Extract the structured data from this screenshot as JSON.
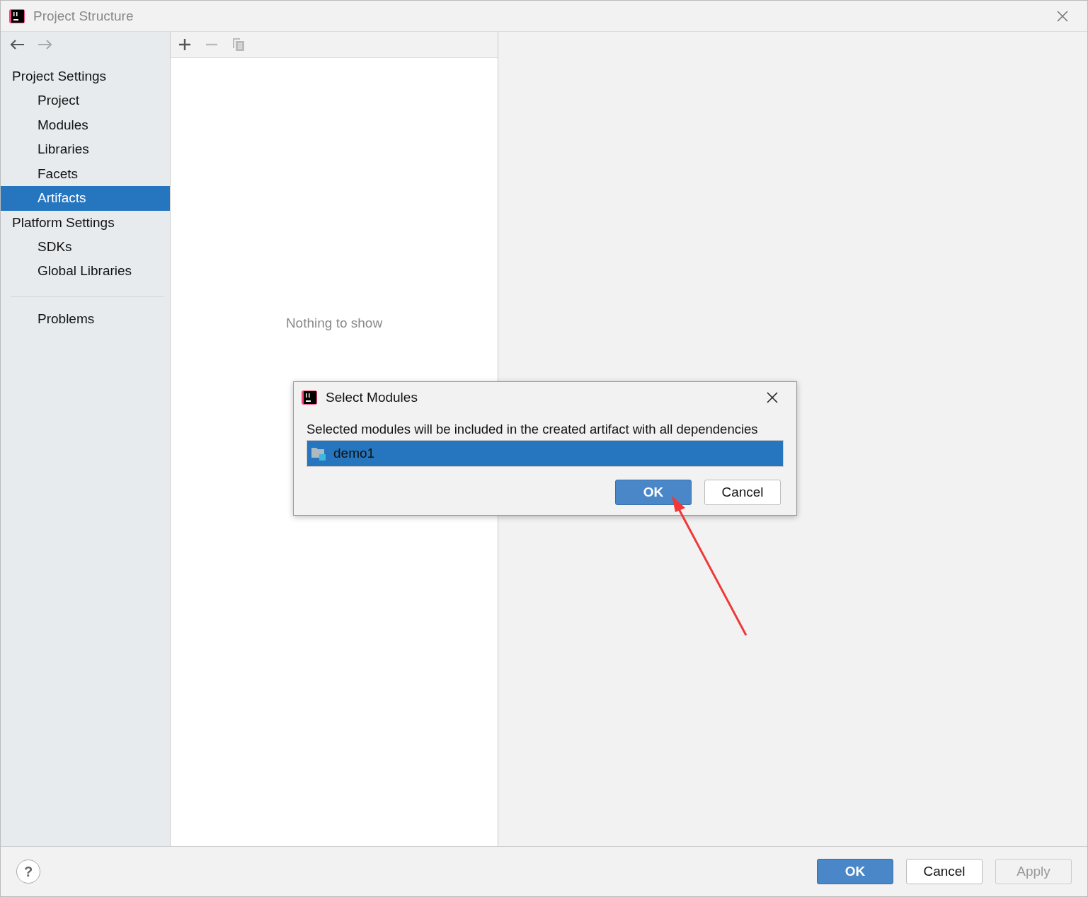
{
  "window": {
    "title": "Project Structure"
  },
  "sidebar": {
    "items": [
      {
        "kind": "header",
        "label": "Project Settings"
      },
      {
        "kind": "item",
        "label": "Project",
        "selected": false
      },
      {
        "kind": "item",
        "label": "Modules",
        "selected": false
      },
      {
        "kind": "item",
        "label": "Libraries",
        "selected": false
      },
      {
        "kind": "item",
        "label": "Facets",
        "selected": false
      },
      {
        "kind": "item",
        "label": "Artifacts",
        "selected": true
      },
      {
        "kind": "header",
        "label": "Platform Settings"
      },
      {
        "kind": "item",
        "label": "SDKs",
        "selected": false
      },
      {
        "kind": "item",
        "label": "Global Libraries",
        "selected": false
      }
    ],
    "bottom_items": [
      {
        "label": "Problems",
        "selected": false
      }
    ]
  },
  "artifacts_panel": {
    "empty_text": "Nothing to show"
  },
  "dialog": {
    "title": "Select Modules",
    "message": "Selected modules will be included in the created artifact with all dependencies",
    "modules": [
      {
        "name": "demo1",
        "selected": true
      }
    ],
    "buttons": [
      {
        "label": "OK",
        "primary": true,
        "disabled": false
      },
      {
        "label": "Cancel",
        "primary": false,
        "disabled": false
      }
    ]
  },
  "footer": {
    "help": "?",
    "buttons": [
      {
        "label": "OK",
        "primary": true,
        "disabled": false
      },
      {
        "label": "Cancel",
        "primary": false,
        "disabled": false
      },
      {
        "label": "Apply",
        "primary": false,
        "disabled": true
      }
    ]
  }
}
